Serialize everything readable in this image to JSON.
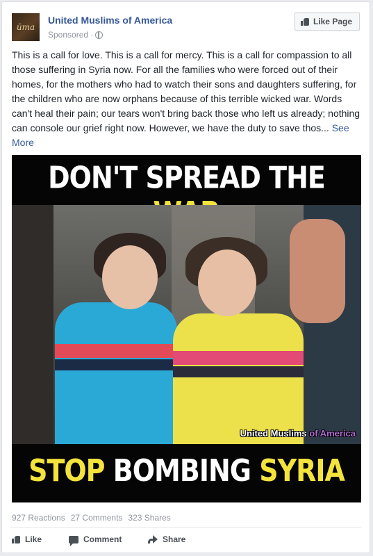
{
  "post": {
    "page_name": "United Muslims of America",
    "avatar_text": "ūma",
    "sponsored_label": "Sponsored ·",
    "like_page_label": "Like Page",
    "body_text": "This is a call for love. This is a call for mercy. This is a call for compassion to all those suffering in Syria now. For all the families who were forced out of their homes, for the mothers who had to watch their sons and daughters suffering, for the children who are now orphans because of this terrible wicked war. Words can't heal their pain; our tears won't bring back those who left us already; nothing can console our grief right now. However, we have the duty to save thos...",
    "see_more_label": "See More"
  },
  "creative": {
    "headline_top_white": "DON'T SPREAD THE",
    "headline_top_yellow": "WAR",
    "headline_bottom_yellow1": "STOP",
    "headline_bottom_white": "BOMBING",
    "headline_bottom_yellow2": "SYRIA",
    "watermark_main": "United Muslims",
    "watermark_accent": "of America"
  },
  "stats": {
    "reactions": "927 Reactions",
    "comments": "27 Comments",
    "shares": "323 Shares"
  },
  "actions": {
    "like": "Like",
    "comment": "Comment",
    "share": "Share"
  },
  "colors": {
    "link_blue": "#365899",
    "headline_yellow": "#f4e33c",
    "meta_gray": "#90949c"
  },
  "icons": {
    "page_privacy": "globe-icon",
    "like_page": "thumbs-up-icon",
    "like_action": "thumbs-up-icon",
    "comment_action": "comment-icon",
    "share_action": "share-arrow-icon"
  }
}
